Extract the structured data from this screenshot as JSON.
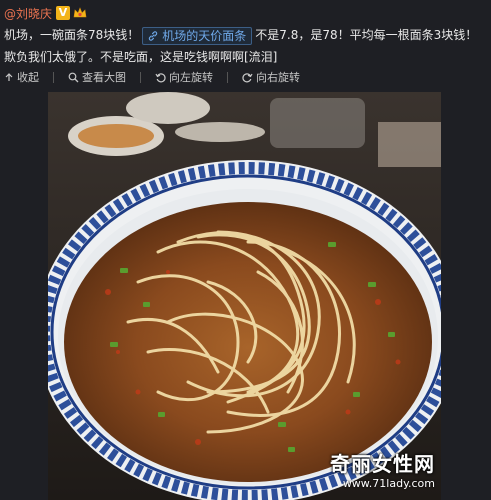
{
  "post": {
    "username": "@刘晓庆",
    "verified_badge": "V",
    "segments": {
      "before_topic": "机场，一碗面条78块钱！",
      "topic": "机场的天价面条",
      "after_topic": "不是7.8，是78！平均每一根面条3块钱！欺负我们太饿了。不是吃面，这是吃钱啊啊啊[流泪]"
    }
  },
  "toolbar": {
    "collapse_label": "收起",
    "view_large_label": "查看大图",
    "rotate_left_label": "向左旋转",
    "rotate_right_label": "向右旋转"
  },
  "photo": {
    "watermark_title": "奇丽女性网",
    "watermark_url": "www.71lady.com"
  },
  "icons": {
    "topic": "link-icon",
    "collapse": "arrow-up-icon",
    "view_large": "magnifier-icon",
    "rotate_left": "rotate-left-icon",
    "rotate_right": "rotate-right-icon"
  },
  "colors": {
    "background": "#1e1f24",
    "username": "#eb7350",
    "topic_link": "#6fa8e8",
    "badge": "#f3b41a"
  }
}
